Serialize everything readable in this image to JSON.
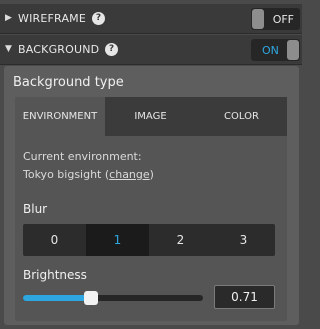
{
  "rows": [
    {
      "label": "WIREFRAME",
      "expanded": false,
      "help_icon": "question-circle-icon",
      "toggle_label": "OFF",
      "toggle_on": false
    },
    {
      "label": "BACKGROUND",
      "expanded": true,
      "help_icon": "question-circle-icon",
      "toggle_label": "ON",
      "toggle_on": true
    }
  ],
  "background_type": {
    "title": "Background type",
    "tabs": [
      "ENVIRONMENT",
      "IMAGE",
      "COLOR"
    ],
    "active_tab": "ENVIRONMENT",
    "current_label": "Current environment:",
    "environment_name": "Tokyo bigsight",
    "open_paren": "(",
    "change_link": "change",
    "close_paren": ")"
  },
  "blur": {
    "title": "Blur",
    "options": [
      "0",
      "1",
      "2",
      "3"
    ],
    "selected": "1"
  },
  "brightness": {
    "title": "Brightness",
    "value": "0.71",
    "fraction": 0.37
  },
  "colors": {
    "accent": "#2ea6e0",
    "row_bg": "#3a3a3a",
    "panel_bg": "#5e5e5e"
  }
}
